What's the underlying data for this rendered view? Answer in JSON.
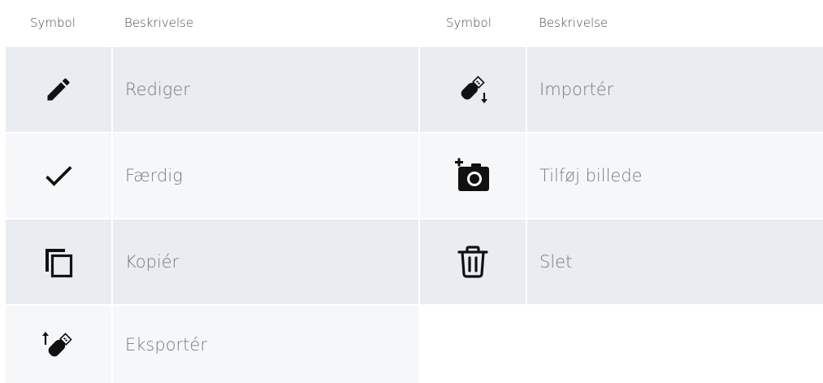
{
  "header": {
    "col1": "Symbol",
    "col2": "Beskrivelse",
    "col3": "Symbol",
    "col4": "Beskrivelse"
  },
  "rows": [
    {
      "left_icon": "pencil-icon",
      "left_label": "Rediger",
      "right_icon": "usb-import-icon",
      "right_label": "Importér"
    },
    {
      "left_icon": "checkmark-icon",
      "left_label": "Færdig",
      "right_icon": "add-photo-icon",
      "right_label": "Tilføj billede"
    },
    {
      "left_icon": "copy-icon",
      "left_label": "Kopiér",
      "right_icon": "trash-icon",
      "right_label": "Slet"
    },
    {
      "left_icon": "usb-export-icon",
      "left_label": "Eksportér",
      "right_icon": "",
      "right_label": ""
    }
  ],
  "colors": {
    "row_dark": "#e9ecf0",
    "row_light": "#f6f7f9",
    "icon": "#111111",
    "text": "#7a7a7a"
  }
}
